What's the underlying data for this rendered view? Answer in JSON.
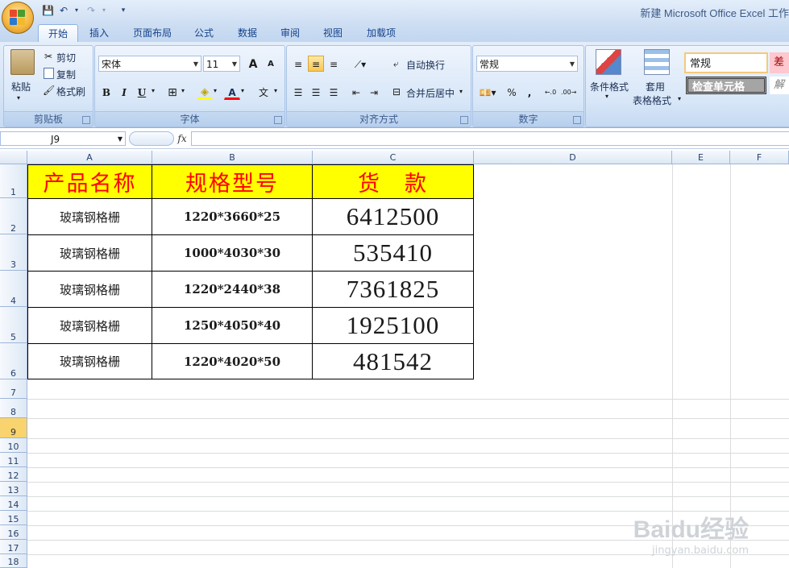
{
  "window": {
    "title": "新建 Microsoft Office Excel 工作"
  },
  "tabs": [
    "开始",
    "插入",
    "页面布局",
    "公式",
    "数据",
    "审阅",
    "视图",
    "加载项"
  ],
  "ribbon": {
    "clipboard": {
      "paste": "粘贴",
      "cut": "剪切",
      "copy": "复制",
      "format_painter": "格式刷",
      "label": "剪贴板"
    },
    "font": {
      "name": "宋体",
      "size": "11",
      "grow": "A",
      "shrink": "A",
      "bold": "B",
      "italic": "I",
      "underline": "U",
      "label": "字体"
    },
    "alignment": {
      "wrap_text": "自动换行",
      "merge_center": "合并后居中",
      "label": "对齐方式"
    },
    "number": {
      "format": "常规",
      "percent": "%",
      "comma": ",",
      "label": "数字"
    },
    "styles": {
      "conditional": "条件格式",
      "as_table_1": "套用",
      "as_table_2": "表格格式",
      "normal": "常规",
      "bad": "差",
      "check_cell": "检查单元格",
      "explanatory": "解"
    }
  },
  "formula_bar": {
    "name_box": "J9",
    "fx": "fx",
    "value": ""
  },
  "columns": [
    "A",
    "B",
    "C",
    "D",
    "E",
    "F"
  ],
  "rows": [
    "1",
    "2",
    "3",
    "4",
    "5",
    "6",
    "7",
    "8",
    "9",
    "10",
    "11",
    "12",
    "13",
    "14",
    "15",
    "16",
    "17",
    "18"
  ],
  "selected_row": "9",
  "table": {
    "headers": [
      "产品名称",
      "规格型号",
      "货　款"
    ],
    "rows": [
      [
        "玻璃钢格栅",
        "1220*3660*25",
        "6412500"
      ],
      [
        "玻璃钢格栅",
        "1000*4030*30",
        "535410"
      ],
      [
        "玻璃钢格栅",
        "1220*2440*38",
        "7361825"
      ],
      [
        "玻璃钢格栅",
        "1250*4050*40",
        "1925100"
      ],
      [
        "玻璃钢格栅",
        "1220*4020*50",
        "481542"
      ]
    ]
  },
  "watermark": {
    "brand": "Baidu经验",
    "url": "jingyan.baidu.com"
  },
  "colors": {
    "header_fill": "#ffff00",
    "header_text": "#ff0000",
    "ribbon_bg": "#d5e4f6",
    "selected_row": "#f8d36e"
  }
}
